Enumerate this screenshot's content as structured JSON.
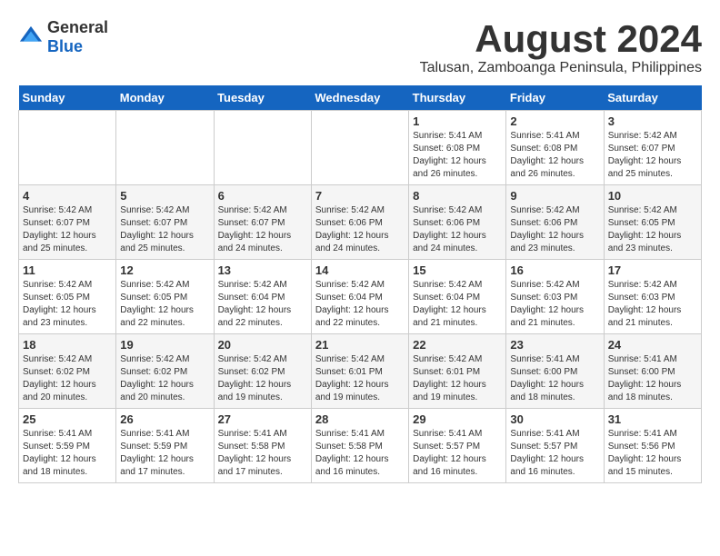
{
  "logo": {
    "text_general": "General",
    "text_blue": "Blue"
  },
  "header": {
    "title": "August 2024",
    "subtitle": "Talusan, Zamboanga Peninsula, Philippines"
  },
  "weekdays": [
    "Sunday",
    "Monday",
    "Tuesday",
    "Wednesday",
    "Thursday",
    "Friday",
    "Saturday"
  ],
  "weeks": [
    [
      {
        "day": "",
        "info": ""
      },
      {
        "day": "",
        "info": ""
      },
      {
        "day": "",
        "info": ""
      },
      {
        "day": "",
        "info": ""
      },
      {
        "day": "1",
        "info": "Sunrise: 5:41 AM\nSunset: 6:08 PM\nDaylight: 12 hours\nand 26 minutes."
      },
      {
        "day": "2",
        "info": "Sunrise: 5:41 AM\nSunset: 6:08 PM\nDaylight: 12 hours\nand 26 minutes."
      },
      {
        "day": "3",
        "info": "Sunrise: 5:42 AM\nSunset: 6:07 PM\nDaylight: 12 hours\nand 25 minutes."
      }
    ],
    [
      {
        "day": "4",
        "info": "Sunrise: 5:42 AM\nSunset: 6:07 PM\nDaylight: 12 hours\nand 25 minutes."
      },
      {
        "day": "5",
        "info": "Sunrise: 5:42 AM\nSunset: 6:07 PM\nDaylight: 12 hours\nand 25 minutes."
      },
      {
        "day": "6",
        "info": "Sunrise: 5:42 AM\nSunset: 6:07 PM\nDaylight: 12 hours\nand 24 minutes."
      },
      {
        "day": "7",
        "info": "Sunrise: 5:42 AM\nSunset: 6:06 PM\nDaylight: 12 hours\nand 24 minutes."
      },
      {
        "day": "8",
        "info": "Sunrise: 5:42 AM\nSunset: 6:06 PM\nDaylight: 12 hours\nand 24 minutes."
      },
      {
        "day": "9",
        "info": "Sunrise: 5:42 AM\nSunset: 6:06 PM\nDaylight: 12 hours\nand 23 minutes."
      },
      {
        "day": "10",
        "info": "Sunrise: 5:42 AM\nSunset: 6:05 PM\nDaylight: 12 hours\nand 23 minutes."
      }
    ],
    [
      {
        "day": "11",
        "info": "Sunrise: 5:42 AM\nSunset: 6:05 PM\nDaylight: 12 hours\nand 23 minutes."
      },
      {
        "day": "12",
        "info": "Sunrise: 5:42 AM\nSunset: 6:05 PM\nDaylight: 12 hours\nand 22 minutes."
      },
      {
        "day": "13",
        "info": "Sunrise: 5:42 AM\nSunset: 6:04 PM\nDaylight: 12 hours\nand 22 minutes."
      },
      {
        "day": "14",
        "info": "Sunrise: 5:42 AM\nSunset: 6:04 PM\nDaylight: 12 hours\nand 22 minutes."
      },
      {
        "day": "15",
        "info": "Sunrise: 5:42 AM\nSunset: 6:04 PM\nDaylight: 12 hours\nand 21 minutes."
      },
      {
        "day": "16",
        "info": "Sunrise: 5:42 AM\nSunset: 6:03 PM\nDaylight: 12 hours\nand 21 minutes."
      },
      {
        "day": "17",
        "info": "Sunrise: 5:42 AM\nSunset: 6:03 PM\nDaylight: 12 hours\nand 21 minutes."
      }
    ],
    [
      {
        "day": "18",
        "info": "Sunrise: 5:42 AM\nSunset: 6:02 PM\nDaylight: 12 hours\nand 20 minutes."
      },
      {
        "day": "19",
        "info": "Sunrise: 5:42 AM\nSunset: 6:02 PM\nDaylight: 12 hours\nand 20 minutes."
      },
      {
        "day": "20",
        "info": "Sunrise: 5:42 AM\nSunset: 6:02 PM\nDaylight: 12 hours\nand 19 minutes."
      },
      {
        "day": "21",
        "info": "Sunrise: 5:42 AM\nSunset: 6:01 PM\nDaylight: 12 hours\nand 19 minutes."
      },
      {
        "day": "22",
        "info": "Sunrise: 5:42 AM\nSunset: 6:01 PM\nDaylight: 12 hours\nand 19 minutes."
      },
      {
        "day": "23",
        "info": "Sunrise: 5:41 AM\nSunset: 6:00 PM\nDaylight: 12 hours\nand 18 minutes."
      },
      {
        "day": "24",
        "info": "Sunrise: 5:41 AM\nSunset: 6:00 PM\nDaylight: 12 hours\nand 18 minutes."
      }
    ],
    [
      {
        "day": "25",
        "info": "Sunrise: 5:41 AM\nSunset: 5:59 PM\nDaylight: 12 hours\nand 18 minutes."
      },
      {
        "day": "26",
        "info": "Sunrise: 5:41 AM\nSunset: 5:59 PM\nDaylight: 12 hours\nand 17 minutes."
      },
      {
        "day": "27",
        "info": "Sunrise: 5:41 AM\nSunset: 5:58 PM\nDaylight: 12 hours\nand 17 minutes."
      },
      {
        "day": "28",
        "info": "Sunrise: 5:41 AM\nSunset: 5:58 PM\nDaylight: 12 hours\nand 16 minutes."
      },
      {
        "day": "29",
        "info": "Sunrise: 5:41 AM\nSunset: 5:57 PM\nDaylight: 12 hours\nand 16 minutes."
      },
      {
        "day": "30",
        "info": "Sunrise: 5:41 AM\nSunset: 5:57 PM\nDaylight: 12 hours\nand 16 minutes."
      },
      {
        "day": "31",
        "info": "Sunrise: 5:41 AM\nSunset: 5:56 PM\nDaylight: 12 hours\nand 15 minutes."
      }
    ]
  ]
}
